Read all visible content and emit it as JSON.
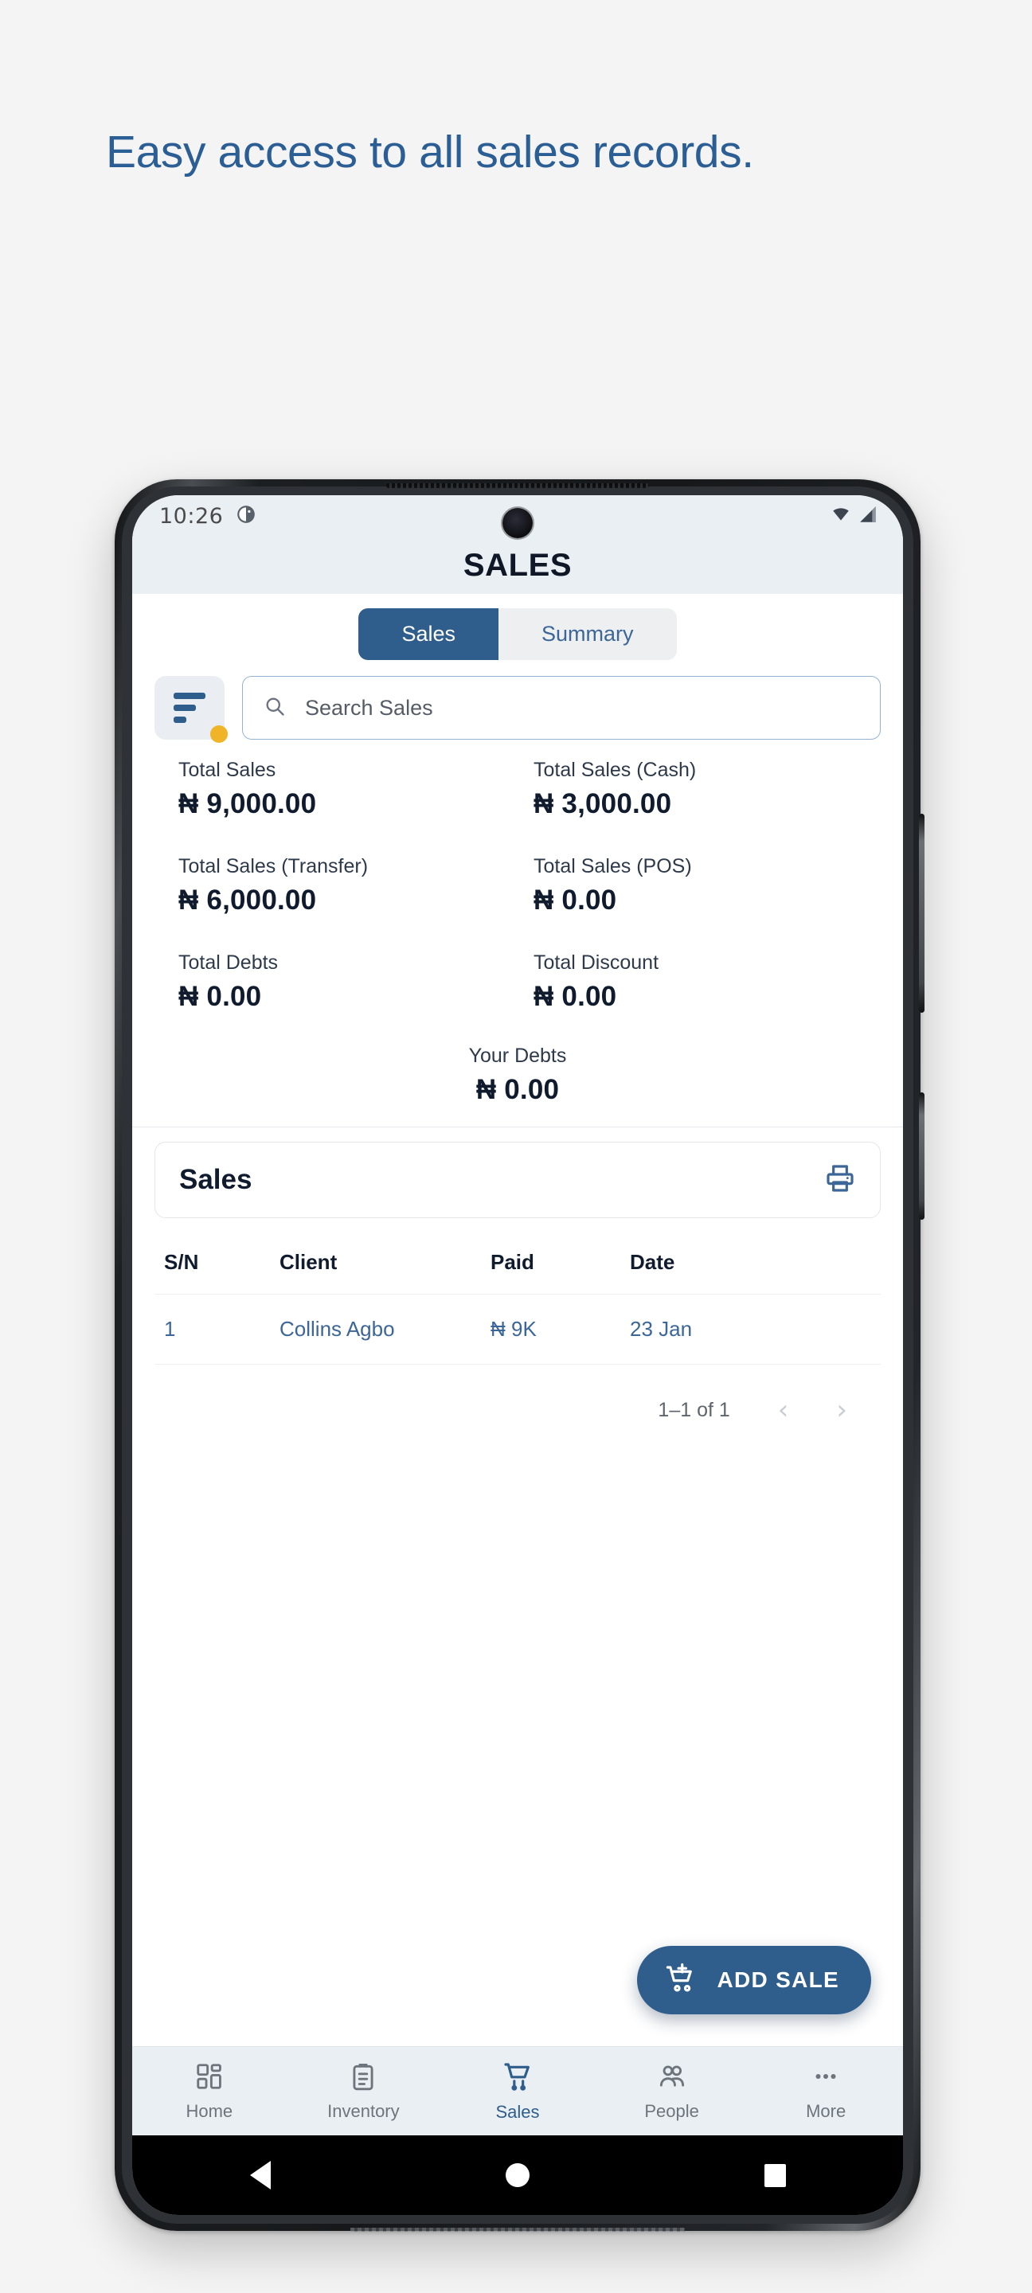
{
  "promo": {
    "heading": "Easy access to all sales records."
  },
  "colors": {
    "page_background": "#f4f4f4",
    "brand_blue": "#2f5d8c",
    "heading_blue": "#2b5e94",
    "link_blue": "#3b6697",
    "value_dark": "#101b2e",
    "badge_amber": "#f0b429",
    "status_bar_bg": "#eaeff3"
  },
  "status_bar": {
    "time": "10:26",
    "left_icons": [
      "screenshot-capture-icon"
    ],
    "right_icons": [
      "wifi-icon",
      "cellular-signal-icon"
    ]
  },
  "app_bar": {
    "title": "SALES"
  },
  "tabs": [
    {
      "label": "Sales",
      "active": true,
      "name": "tab-sales"
    },
    {
      "label": "Summary",
      "active": false,
      "name": "tab-summary"
    }
  ],
  "search": {
    "placeholder": "Search Sales",
    "value": "",
    "icon": "search-icon",
    "filter_icon": "filter-lines-icon",
    "filter_badge_active": true
  },
  "stats": [
    {
      "label": "Total Sales",
      "currency": "₦",
      "value": "9,000.00"
    },
    {
      "label": "Total Sales (Cash)",
      "currency": "₦",
      "value": "3,000.00"
    },
    {
      "label": "Total Sales (Transfer)",
      "currency": "₦",
      "value": "6,000.00"
    },
    {
      "label": "Total Sales (POS)",
      "currency": "₦",
      "value": "0.00"
    },
    {
      "label": "Total Debts",
      "currency": "₦",
      "value": "0.00"
    },
    {
      "label": "Total Discount",
      "currency": "₦",
      "value": "0.00"
    }
  ],
  "your_debts": {
    "label": "Your Debts",
    "currency": "₦",
    "value": "0.00"
  },
  "sales_card": {
    "title": "Sales",
    "print_icon": "printer-icon"
  },
  "table": {
    "columns": [
      "S/N",
      "Client",
      "Paid",
      "Date"
    ],
    "rows": [
      {
        "sn": "1",
        "client": "Collins Agbo",
        "paid": "₦ 9K",
        "date": "23 Jan"
      }
    ]
  },
  "pagination": {
    "range_text": "1–1 of 1",
    "prev_icon": "chevron-left-icon",
    "next_icon": "chevron-right-icon",
    "prev_enabled": false,
    "next_enabled": false
  },
  "fab": {
    "label": "ADD SALE",
    "icon": "cart-plus-icon"
  },
  "bottom_nav": [
    {
      "label": "Home",
      "icon": "dashboard-grid-icon",
      "active": false
    },
    {
      "label": "Inventory",
      "icon": "clipboard-list-icon",
      "active": false
    },
    {
      "label": "Sales",
      "icon": "shopping-cart-icon",
      "active": true
    },
    {
      "label": "People",
      "icon": "people-icon",
      "active": false
    },
    {
      "label": "More",
      "icon": "ellipsis-icon",
      "active": false
    }
  ],
  "system_nav": {
    "back": "android-back-icon",
    "home": "android-home-icon",
    "recents": "android-recents-icon"
  }
}
